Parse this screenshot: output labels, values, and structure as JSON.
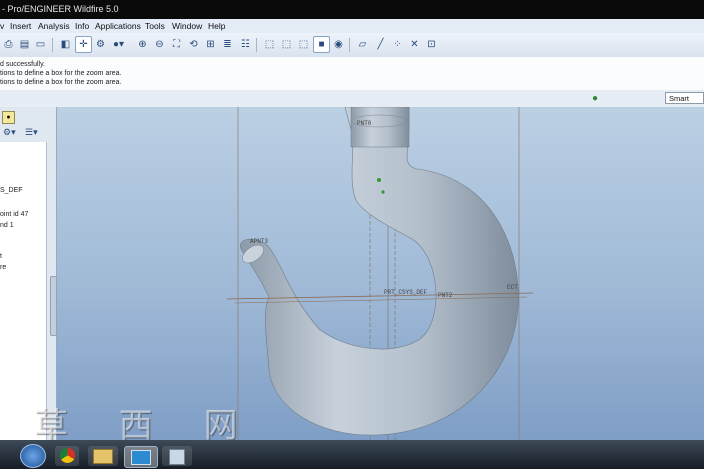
{
  "window": {
    "title": "- Pro/ENGINEER Wildfire 5.0"
  },
  "menu": [
    "v",
    "Insert",
    "Analysis",
    "Info",
    "Applications",
    "Tools",
    "Window",
    "Help"
  ],
  "toolbar": {
    "icons": [
      "print-icon",
      "print-preview-icon",
      "save-copy-icon",
      "repaint-icon",
      "spin-center-icon",
      "orient-mode-icon",
      "display-style-icon",
      "zoom-in-icon",
      "zoom-out-icon",
      "refit-icon",
      "reorient-icon",
      "saved-views-icon",
      "layers-icon",
      "wireframe-icon",
      "hidden-line-icon",
      "no-hidden-icon",
      "shading-icon",
      "enhanced-realism-icon",
      "datum-planes-icon",
      "datum-axes-icon",
      "datum-points-icon",
      "coordinate-systems-icon",
      "annotations-icon"
    ],
    "active": [
      "spin-center-icon",
      "shading-icon"
    ]
  },
  "messages": [
    "d successfully.",
    "tions to define a box for the zoom area.",
    "tions to define a box for the zoom area."
  ],
  "statusbar": {
    "filter_value": "Smart"
  },
  "model_tree": {
    "items": [
      "S_DEF",
      "oint id 47",
      "nd 1",
      "t",
      "re"
    ]
  },
  "viewport": {
    "datum_labels": {
      "top": "PNT0",
      "left": "APNT3",
      "csys": "PRT_CSYS_DEF",
      "pnt": "PNT2",
      "right": "ECT"
    }
  },
  "watermark": {
    "text": "草 西 网"
  },
  "taskbar": {
    "items": [
      "start-button",
      "chrome-icon",
      "file-explorer-icon",
      "proe-icon",
      "app-icon"
    ]
  }
}
